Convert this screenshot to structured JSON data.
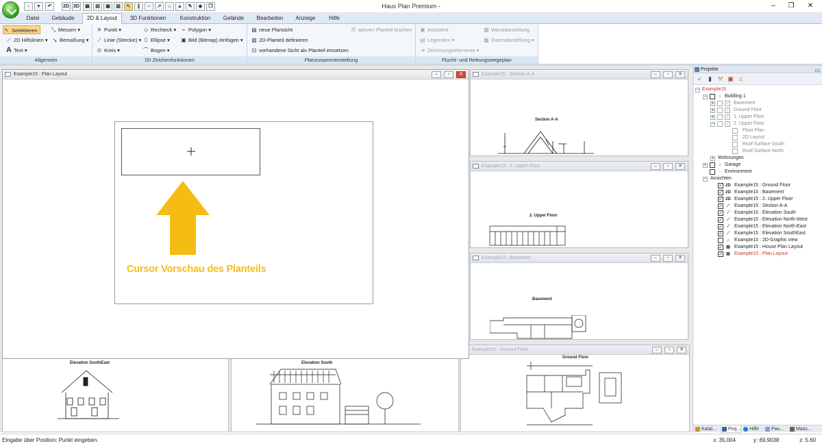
{
  "window": {
    "title": "Haus Plan Premium -",
    "controls": [
      "–",
      "❐",
      "✕"
    ]
  },
  "quick_access": [
    "2D",
    "3D"
  ],
  "tabs": [
    "Datei",
    "Gebäude",
    "2D & Layout",
    "3D Funktionen",
    "Konstruktion",
    "Gelände",
    "Bearbeiten",
    "Anzeige",
    "Hilfe"
  ],
  "active_tab": "2D & Layout",
  "ribbon": {
    "allgemein": {
      "label": "Allgemein",
      "items": [
        "Selektieren",
        "Messen",
        "2D Hilfslinien",
        "Bemaßung",
        "Text"
      ]
    },
    "zeichen": {
      "label": "2D Zeichenfunktionen",
      "items": [
        "Punkt",
        "Rechteck",
        "Polygon",
        "Linie (Strecke)",
        "Ellipse",
        "Bild (Bitmap) einfügen",
        "Kreis",
        "Bogen"
      ]
    },
    "plan": {
      "label": "Planzusammenstellung",
      "items": [
        "neue Plansicht",
        "aktiven Planteil löschen",
        "2D-Planteil definieren",
        "vorhandene Sicht als Planteil einsetzen"
      ]
    },
    "flucht": {
      "label": "Flucht- und Rettungswegeplan",
      "items": [
        "Assistent",
        "Wanddarstellung",
        "Legenden",
        "Raumdarstellung",
        "Zeichnungselemente"
      ]
    }
  },
  "panes": {
    "plan_layout": {
      "title": "Example15 : Plan Layout",
      "preview_text": "Cursor Vorschau des Planteils"
    },
    "section": {
      "title": "Example15 : Section A-A",
      "drawing": "Section A-A"
    },
    "upper": {
      "title": "Example15 : 2. Upper Floor",
      "drawing": "2. Upper Floor"
    },
    "basement": {
      "title": "Example15 : Basement",
      "drawing": "Basement"
    },
    "ground": {
      "title": "Example15 : Ground Floor",
      "drawing": "Ground Floor"
    },
    "elev_se": {
      "drawing": "Elevation SouthEast"
    },
    "elev_s": {
      "drawing": "Elevation South"
    }
  },
  "projects": {
    "title": "Projekte",
    "tree": {
      "root": "Example15",
      "building": "Building 1",
      "floors": [
        "Basement",
        "Ground Floor",
        "1. Upper Floor",
        "2. Upper Floor"
      ],
      "sub": [
        "Floor Plan",
        "2D Layout",
        "Roof Surface South",
        "Roof Surface North"
      ],
      "wohnungen": "Wohnungen",
      "garage": "Garage",
      "environment": "Environment",
      "ansichten": "Ansichten",
      "views": [
        {
          "icon": "2D",
          "label": "Example15 : Ground Floor"
        },
        {
          "icon": "2D",
          "label": "Example15 : Basement"
        },
        {
          "icon": "2D",
          "label": "Example15 : 2. Upper Floor"
        },
        {
          "icon": "",
          "label": "Example15 : Section A-A"
        },
        {
          "icon": "",
          "label": "Example15 : Elevation South"
        },
        {
          "icon": "",
          "label": "Example15 : Elevation North-West"
        },
        {
          "icon": "",
          "label": "Example15 : Elevation North-East"
        },
        {
          "icon": "",
          "label": "Example15 : Elevation SouthEast"
        },
        {
          "icon": "",
          "label": "Example15 : 2D-Graphic view"
        },
        {
          "icon": "",
          "label": "Example15 : House Plan Layout"
        },
        {
          "icon": "",
          "label": "Example15 : Plan Layout"
        }
      ]
    },
    "bottom_tabs": [
      "Katal...",
      "Proj...",
      "Hilfe",
      "Pau...",
      "Mass..."
    ]
  },
  "status": {
    "message": "Eingabe über Position: Punkt eingeben.",
    "x": "x: 35,004",
    "y": "y: 69,9038",
    "z": "z: 5.60"
  },
  "colors": {
    "accent": "#f5bd14",
    "ribbon": "#f3f7fc",
    "tab_bar": "#dfe9f5",
    "tree_red": "#c0392b"
  }
}
